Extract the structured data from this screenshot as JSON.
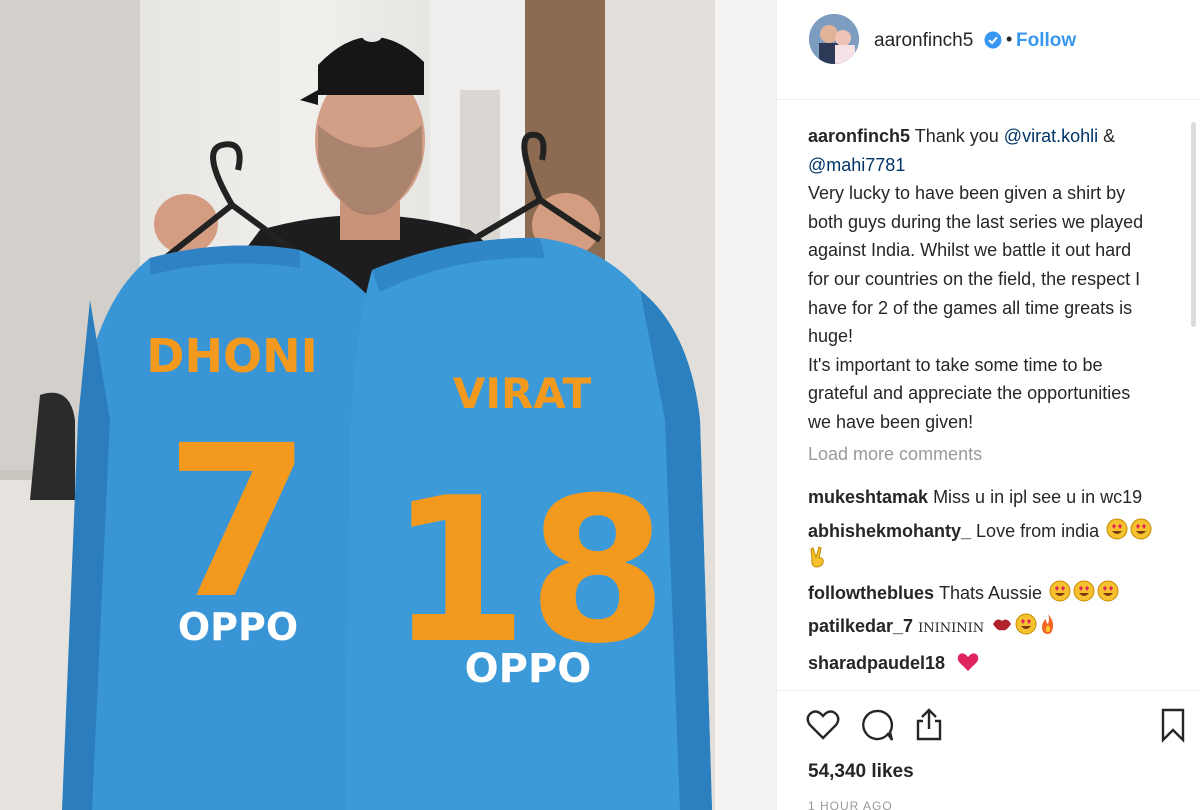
{
  "post": {
    "username": "aaronfinch5",
    "follow_label": "Follow",
    "dot": "•",
    "verified_icon": "verified-badge-icon",
    "accent_color": "#3897f0"
  },
  "photo": {
    "left_jersey": {
      "name": "DHONI",
      "number": "7",
      "sponsor": "OPPO"
    },
    "right_jersey": {
      "name": "VIRAT",
      "number": "18",
      "sponsor": "OPPO"
    }
  },
  "caption": {
    "username": "aaronfinch5",
    "intro": "Thank you",
    "mention1": "@virat.kohli",
    "amp": "&",
    "mention2": "@mahi7781",
    "lines": [
      "Very lucky to have been given a shirt by",
      "both guys during the last series we played",
      "against India. Whilst we battle it out hard",
      "for our countries on the field, the respect I",
      "have for 2 of the games all time greats is",
      "huge!",
      "It's important to take some time to be",
      "grateful and appreciate the opportunities",
      "we have been given!"
    ]
  },
  "load_more": "Load more comments",
  "comments": [
    {
      "user": "mukeshtamak",
      "text": "Miss u in ipl see u in wc19"
    },
    {
      "user": "abhishekmohanty_",
      "text": "Love from india"
    },
    {
      "user": "followtheblues",
      "text": "Thats Aussie"
    },
    {
      "user": "patilkedar_7",
      "text": "ININININ"
    },
    {
      "user": "sharadpaudel18",
      "text": ""
    }
  ],
  "actions": {
    "icons": [
      "heart-icon",
      "comment-icon",
      "share-icon",
      "bookmark-icon"
    ],
    "likes": "54,340 likes",
    "time": "1 HOUR AGO"
  }
}
